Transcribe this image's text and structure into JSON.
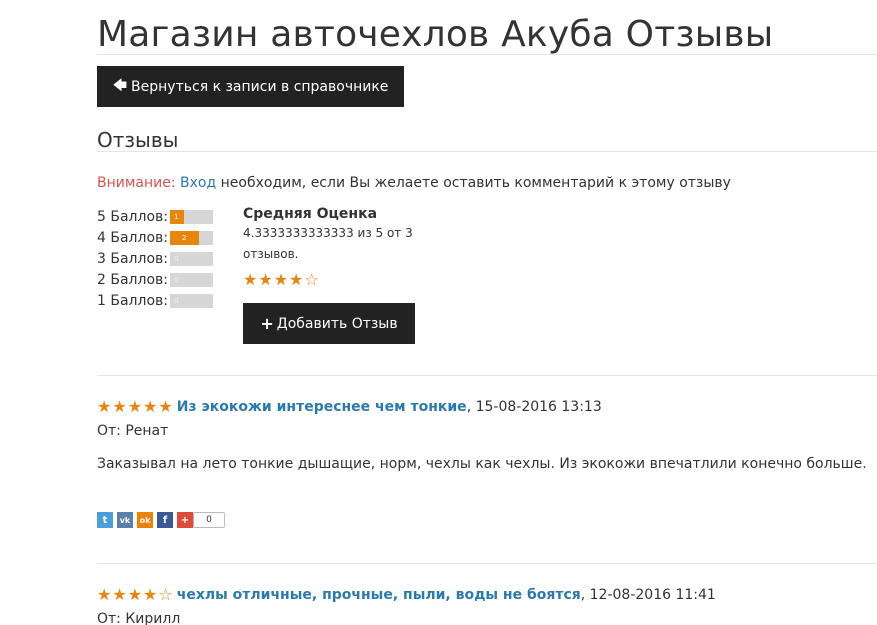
{
  "page": {
    "title": "Магазин авточехлов Акуба Отзывы",
    "back_button": "Вернуться к записи в справочнике",
    "section_title": "Отзывы"
  },
  "notice": {
    "warning": "Внимание:",
    "login_link": "Вход",
    "text": "необходим, если Вы желаете оставить комментарий к этому отзыву"
  },
  "ratings": [
    {
      "label": "5 Баллов:",
      "count": "1",
      "fraction": 0.33
    },
    {
      "label": "4 Баллов:",
      "count": "2",
      "fraction": 0.67
    },
    {
      "label": "3 Баллов:",
      "count": "0",
      "fraction": 0
    },
    {
      "label": "2 Баллов:",
      "count": "0",
      "fraction": 0
    },
    {
      "label": "1 Баллов:",
      "count": "0",
      "fraction": 0
    }
  ],
  "average": {
    "title": "Средняя Оценка",
    "text": "4.3333333333333 из 5 от 3 отзывов.",
    "stars": "★★★★☆"
  },
  "add_button": "Добавить Отзыв",
  "reviews": [
    {
      "stars": "★★★★★",
      "title": "Из экокожи интереснее чем тонкие",
      "date": ", 15-08-2016 13:13",
      "author": "От: Ренат",
      "body": "Заказывал на лето тонкие дышащие, норм, чехлы как чехлы. Из экокожи впечатлили конечно больше."
    },
    {
      "stars": "★★★★☆",
      "title": "чехлы отличные, прочные, пыли, воды не боятся",
      "date": ", 12-08-2016 11:41",
      "author": "От: Кирилл"
    }
  ],
  "share": {
    "buttons": [
      {
        "icon": "twitter-icon",
        "glyph": "t",
        "color": "#4a9fd9"
      },
      {
        "icon": "vkontakte-icon",
        "glyph": "vk",
        "color": "#5b7fa6"
      },
      {
        "icon": "odnoklassniki-icon",
        "glyph": "ok",
        "color": "#ee8208"
      },
      {
        "icon": "facebook-icon",
        "glyph": "f",
        "color": "#3b5998"
      },
      {
        "icon": "google-plus-icon",
        "glyph": "+",
        "color": "#dd4b39"
      }
    ],
    "count": "0"
  },
  "colors": {
    "accent": "#e8850c",
    "link": "#2a7ab0",
    "warning": "#d9534f",
    "button": "#222222"
  }
}
